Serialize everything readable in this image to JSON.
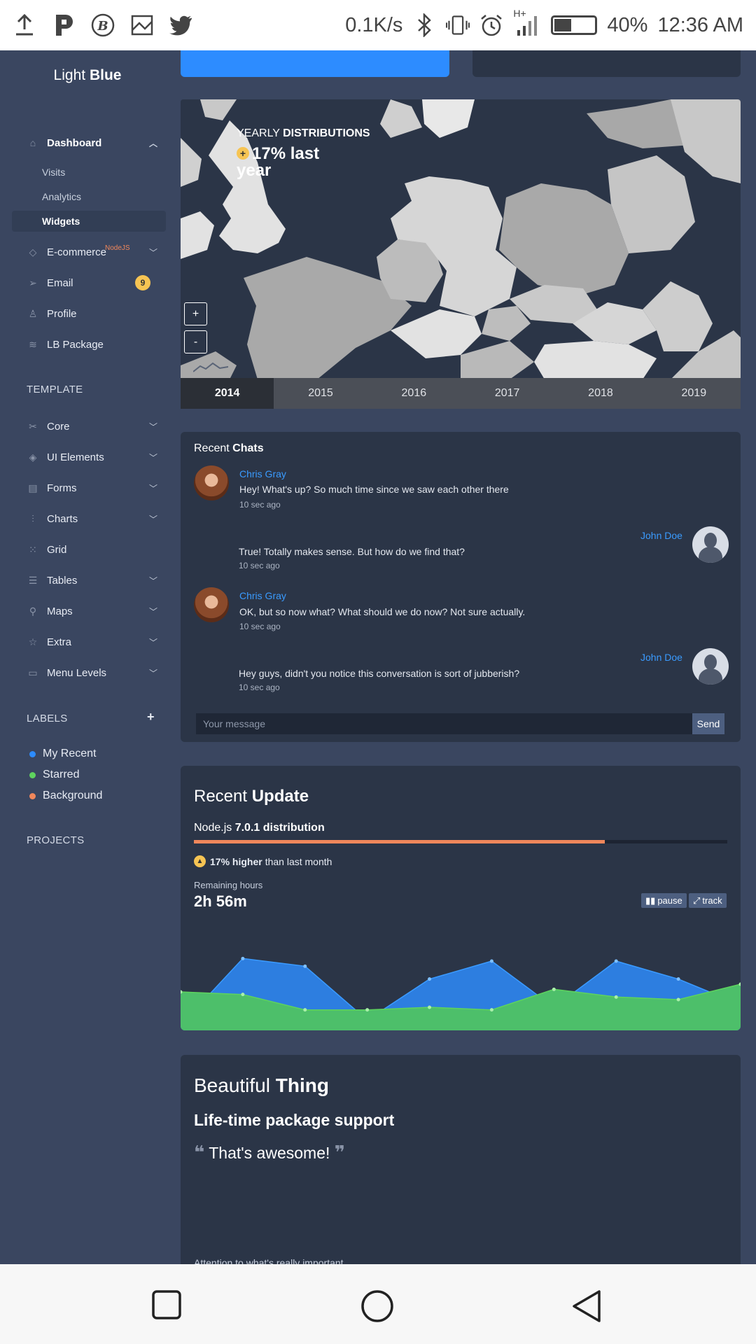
{
  "status_bar": {
    "net_speed": "0.1K/s",
    "network": "H+",
    "battery": "40%",
    "time": "12:36 AM",
    "icons": [
      "upload-icon",
      "p-app-icon",
      "bitcoin-icon",
      "image-icon",
      "twitter-icon",
      "bluetooth-icon",
      "vibrate-icon",
      "alarm-icon",
      "signal-icon",
      "battery-icon"
    ]
  },
  "sidebar": {
    "logo_light": "Light",
    "logo_bold": "Blue",
    "dashboard": "Dashboard",
    "sub_items": [
      "Visits",
      "Analytics",
      "Widgets"
    ],
    "ecommerce": "E-commerce",
    "ecommerce_tag": "NodeJS",
    "email": "Email",
    "email_badge": "9",
    "profile": "Profile",
    "lb_package": "LB Package",
    "template_title": "TEMPLATE",
    "template_items": [
      "Core",
      "UI Elements",
      "Forms",
      "Charts",
      "Grid",
      "Tables",
      "Maps",
      "Extra",
      "Menu Levels"
    ],
    "labels_title": "LABELS",
    "labels_add": "+",
    "labels": [
      {
        "label": "My Recent",
        "color": "#2d8cff"
      },
      {
        "label": "Starred",
        "color": "#5ed35e"
      },
      {
        "label": "Background",
        "color": "#f0875b"
      }
    ],
    "projects_title": "PROJECTS"
  },
  "map": {
    "title_thin": "YEARLY",
    "title_bold": "DISTRIBUTIONS",
    "change": "17% last year",
    "zoom_in": "+",
    "zoom_out": "-",
    "years": [
      "2014",
      "2015",
      "2016",
      "2017",
      "2018",
      "2019"
    ],
    "active_year": "2014"
  },
  "chats": {
    "title_thin": "Recent",
    "title_bold": "Chats",
    "messages": [
      {
        "name": "Chris Gray",
        "text": "Hey! What's up? So much time since we saw each other there",
        "time": "10 sec ago"
      },
      {
        "name": "John Doe",
        "text": "True! Totally makes sense. But how do we find that?",
        "time": "10 sec ago"
      },
      {
        "name": "Chris Gray",
        "text": "OK, but so now what? What should we do now? Not sure actually.",
        "time": "10 sec ago"
      },
      {
        "name": "John Doe",
        "text": "Hey guys, didn't you notice this conversation is sort of jubberish?",
        "time": "10 sec ago"
      }
    ],
    "input_placeholder": "Your message",
    "send_label": "Send"
  },
  "update": {
    "title_thin": "Recent",
    "title_bold": "Update",
    "dist_thin": "Node.js",
    "dist_bold": "7.0.1 distribution",
    "progress": 0.77,
    "higher_bold": "17% higher",
    "higher_rest": "than last month",
    "remaining_label": "Remaining hours",
    "remaining_value": "2h 56m",
    "pause_label": "pause",
    "track_label": "track",
    "colors": {
      "blue": "#2d7ee0",
      "green": "#4dbf6a"
    },
    "blue_series": [
      2,
      28,
      25,
      4,
      20,
      27,
      9,
      27,
      20,
      10
    ],
    "green_series": [
      15,
      14,
      8,
      8,
      9,
      8,
      16,
      13,
      12,
      18
    ]
  },
  "thing": {
    "title_thin": "Beautiful",
    "title_bold": "Thing",
    "subtitle": "Life-time package support",
    "quote": "That's awesome!",
    "attention": "Attention to what's really important"
  }
}
